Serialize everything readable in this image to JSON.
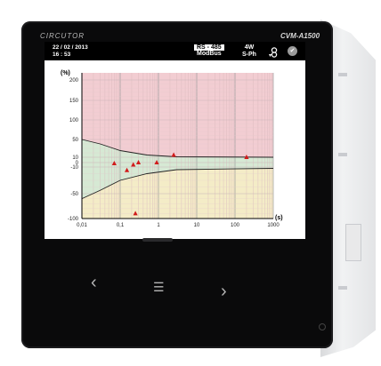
{
  "device": {
    "brand": "CIRCUTOR",
    "model": "CVM-A1500"
  },
  "status_bar": {
    "date": "22 / 02 / 2013",
    "time": "16 : 53",
    "comm_top": "RS - 485",
    "comm_bottom": "ModBus",
    "wiring_top": "4W",
    "wiring_bottom": "S-Ph",
    "ok_icon": "check-icon"
  },
  "chart_data": {
    "type": "scatter",
    "ylabel": "(%)",
    "xlabel": "(s)",
    "x_scale": "log",
    "xlim": [
      0.01,
      1000
    ],
    "y_ticks": [
      200,
      150,
      100,
      50,
      10,
      0,
      -10,
      -50,
      -100
    ],
    "x_tick_labels": [
      "0,01",
      "0,1",
      "1",
      "10",
      "100",
      "1000"
    ],
    "x_ticks": [
      0.01,
      0.1,
      1,
      10,
      100,
      1000
    ],
    "regions": [
      {
        "name": "overvoltage",
        "color": "#f2cdd2"
      },
      {
        "name": "tolerance",
        "color": "#d6e9d4"
      },
      {
        "name": "undervoltage",
        "color": "#f4ecc7"
      }
    ],
    "points": [
      {
        "x": 0.07,
        "y": -2
      },
      {
        "x": 0.15,
        "y": -15
      },
      {
        "x": 0.22,
        "y": -5
      },
      {
        "x": 0.3,
        "y": 0
      },
      {
        "x": 0.9,
        "y": 0
      },
      {
        "x": 2.5,
        "y": 15
      },
      {
        "x": 200,
        "y": 10
      },
      {
        "x": 0.25,
        "y": -90
      }
    ],
    "marker_color": "#d11b1b"
  },
  "nav": {
    "prev_icon": "chevron-left-icon",
    "menu_icon": "menu-icon",
    "next_icon": "chevron-right-icon"
  }
}
